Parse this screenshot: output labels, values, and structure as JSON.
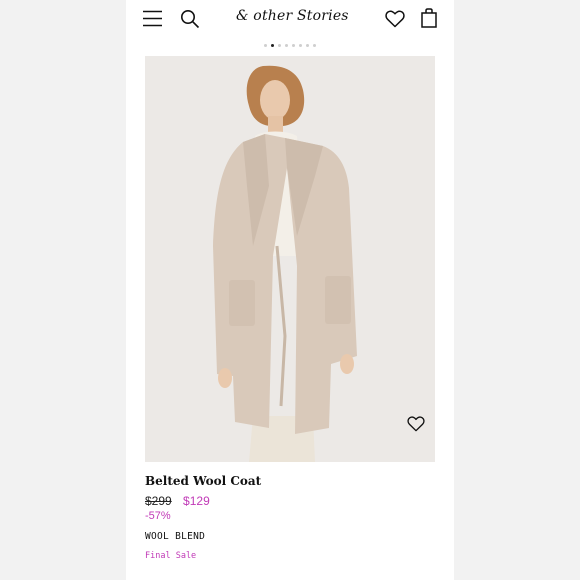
{
  "header": {
    "brand": "& other Stories",
    "icons": [
      "menu-icon",
      "search-icon",
      "heart-icon",
      "bag-icon"
    ]
  },
  "carousel": {
    "total": 8,
    "active_index": 1
  },
  "product": {
    "title": "Belted Wool Coat",
    "old_price": "$299",
    "new_price": "$129",
    "discount": "-57%",
    "material": "WOOL BLEND",
    "sale_note": "Final Sale"
  },
  "colors": {
    "sale": "#c13ab7",
    "coat": "#d9c9ba",
    "image_bg": "#ece9e6"
  }
}
